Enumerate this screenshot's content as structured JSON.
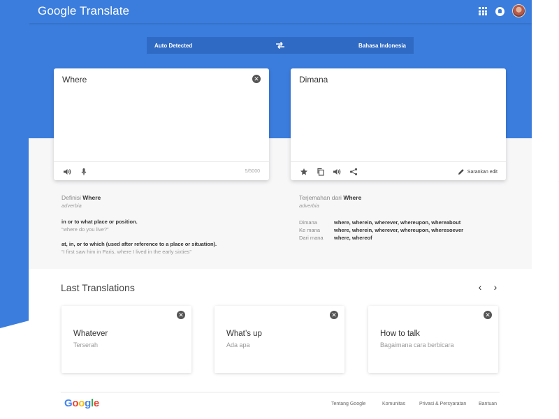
{
  "header": {
    "app_title": "Google Translate",
    "icons": [
      "apps-icon",
      "notifications-icon",
      "avatar"
    ]
  },
  "language_bar": {
    "source": "Auto Detected",
    "target": "Bahasa Indonesia"
  },
  "source_card": {
    "text": "Where",
    "char_count": "5/5000"
  },
  "target_card": {
    "text": "Dimana",
    "suggest_label": "Sarankan edit"
  },
  "definition": {
    "title_prefix": "Definisi",
    "word": "Where",
    "word_type": "adverbia",
    "entries": [
      {
        "meaning": "in or to what place or position.",
        "example": "“where do you live?”"
      },
      {
        "meaning": "at, in, or to which (used after reference to a place or situation).",
        "example": "“I first saw him in Paris, where I lived in the early sixties”"
      }
    ]
  },
  "translations_of": {
    "title_prefix": "Terjemahan dari",
    "word": "Where",
    "word_type": "adverbia",
    "rows": [
      {
        "key": "Dimana",
        "value": "where, wherein, wherever, whereupon, whereabout"
      },
      {
        "key": "Ke mana",
        "value": "where, wherein, wherever, whereupon, wheresoever"
      },
      {
        "key": "Dari mana",
        "value": "where, whereof"
      }
    ]
  },
  "last_translations": {
    "title": "Last Translations",
    "prev": "‹",
    "next": "›",
    "items": [
      {
        "source": "Whatever",
        "target": "Terserah"
      },
      {
        "source": "What’s up",
        "target": "Ada apa"
      },
      {
        "source": "How to talk",
        "target": "Bagaimana cara berbicara"
      }
    ]
  },
  "footer": {
    "logo": [
      "G",
      "o",
      "o",
      "g",
      "l",
      "e"
    ],
    "links": [
      "Tentang Google",
      "Komunitas",
      "Privasi & Persyaratan",
      "Bantuan"
    ]
  },
  "colors": {
    "brand_blue": "#3b7ddd",
    "language_bar": "#2f6ac4",
    "google_logo": [
      "#4285f4",
      "#ea4335",
      "#fbbc05",
      "#4285f4",
      "#34a853",
      "#ea4335"
    ]
  }
}
